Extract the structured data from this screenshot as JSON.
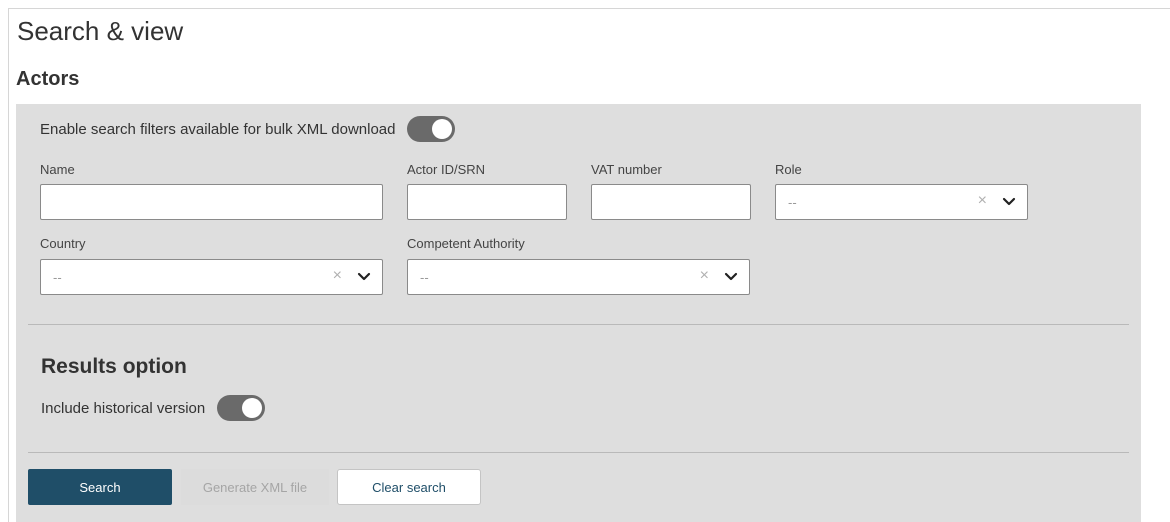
{
  "header": {
    "title": "Search & view",
    "section": "Actors"
  },
  "filters": {
    "bulk_toggle_label": "Enable search filters available for bulk XML download",
    "bulk_toggle_on": true,
    "name": {
      "label": "Name",
      "value": ""
    },
    "actor_id": {
      "label": "Actor ID/SRN",
      "value": ""
    },
    "vat": {
      "label": "VAT number",
      "value": ""
    },
    "role": {
      "label": "Role",
      "selected": "--"
    },
    "country": {
      "label": "Country",
      "selected": "--"
    },
    "authority": {
      "label": "Competent Authority",
      "selected": "--"
    },
    "clear_glyph": "×"
  },
  "results": {
    "title": "Results option",
    "historical_label": "Include historical version",
    "historical_on": true
  },
  "buttons": {
    "search": "Search",
    "generate": "Generate XML file",
    "clear": "Clear search"
  },
  "colors": {
    "primary": "#1f4e68",
    "panel": "#dedede",
    "toggle": "#6a6a6a"
  }
}
